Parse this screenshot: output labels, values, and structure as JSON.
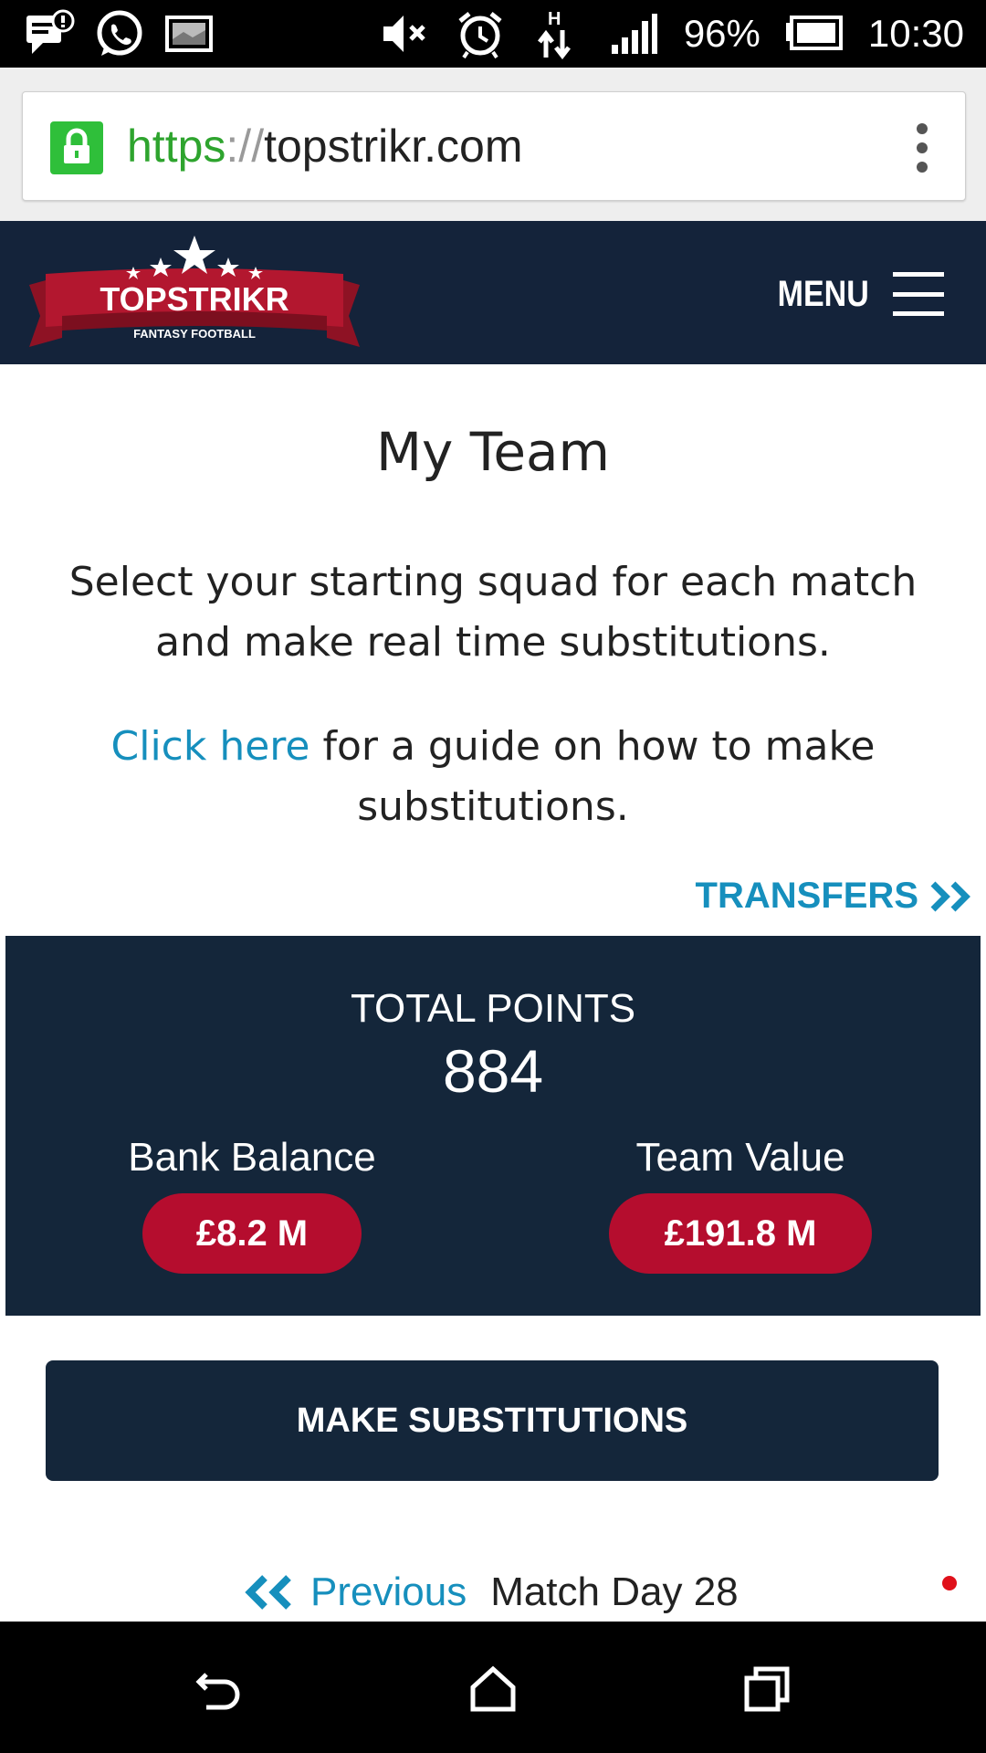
{
  "status_bar": {
    "battery": "96%",
    "time": "10:30",
    "icons": [
      "message-notification-icon",
      "whatsapp-icon",
      "gallery-icon",
      "mute-icon",
      "alarm-icon",
      "data-arrows-icon",
      "signal-icon",
      "battery-icon"
    ]
  },
  "browser": {
    "url_scheme": "https",
    "url_sep": "://",
    "url_host": "topstrikr.com"
  },
  "site_header": {
    "logo_text": "TOPSTRIKR",
    "logo_subtext": "FANTASY FOOTBALL",
    "menu_label": "MENU"
  },
  "page": {
    "title": "My Team",
    "description": "Select your starting squad for each match and make real time substitutions.",
    "guide_link": "Click here",
    "guide_rest": " for a guide on how to make substitutions.",
    "transfers_label": "TRANSFERS"
  },
  "stats": {
    "total_points_label": "TOTAL POINTS",
    "total_points": "884",
    "bank_balance_label": "Bank Balance",
    "bank_balance": "£8.2 M",
    "team_value_label": "Team Value",
    "team_value": "£191.8 M"
  },
  "actions": {
    "make_substitutions": "MAKE SUBSTITUTIONS"
  },
  "match_nav": {
    "previous_label": "Previous",
    "match_day": "Match Day 28"
  },
  "colors": {
    "navy": "#14263a",
    "link_blue": "#168fbd",
    "pill_red": "#b50d2e",
    "url_green": "#2ea42e"
  }
}
